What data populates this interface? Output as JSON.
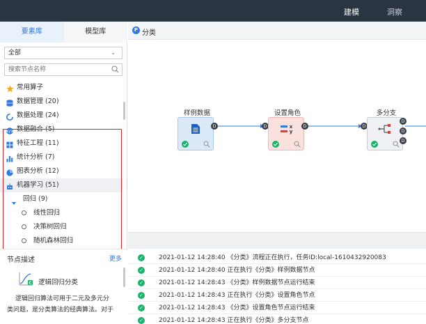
{
  "topbar": {
    "nav": [
      "建模",
      "洞察"
    ]
  },
  "sidebar": {
    "tabs": [
      "要素库",
      "模型库"
    ],
    "filter": {
      "value": "全部"
    },
    "search": {
      "placeholder": "搜索节点名称"
    },
    "items": [
      {
        "label": "常用算子",
        "icon": "star-icon",
        "color": "#f5a623"
      },
      {
        "label": "数据管理 (20)",
        "icon": "database-icon",
        "color": "#2f7ae5"
      },
      {
        "label": "数据处理 (24)",
        "icon": "process-icon",
        "color": "#2f7ae5"
      },
      {
        "label": "数据融合 (5)",
        "icon": "fusion-icon",
        "color": "#2f7ae5"
      },
      {
        "label": "特征工程 (11)",
        "icon": "grid-icon",
        "color": "#2f7ae5"
      },
      {
        "label": "统计分析 (7)",
        "icon": "bar-chart-icon",
        "color": "#2f7ae5"
      },
      {
        "label": "图表分析 (12)",
        "icon": "pie-chart-icon",
        "color": "#2f7ae5"
      },
      {
        "label": "机器学习 (51)",
        "icon": "robot-icon",
        "color": "#2f7ae5"
      },
      {
        "label": "回归 (9)",
        "icon": "caret-down-icon",
        "color": "#2f7ae5"
      },
      {
        "label": "线性回归",
        "icon": "circle-icon",
        "color": "#666666"
      },
      {
        "label": "决策树回归",
        "icon": "circle-icon",
        "color": "#666666"
      },
      {
        "label": "随机森林回归",
        "icon": "circle-icon",
        "color": "#666666"
      }
    ],
    "description": {
      "header": "节点描述",
      "more": "更多",
      "title": "逻辑回归分类",
      "text_line1": "逻辑回归算法可用于二元及多元分",
      "text_line2": "类问题，是分类算法的经典算法。对于"
    }
  },
  "canvas": {
    "title": "分类",
    "nodes": [
      {
        "label": "样例数据",
        "port": "D"
      },
      {
        "label": "设置角色",
        "port": "D"
      },
      {
        "label": "多分支",
        "port": "D"
      }
    ],
    "status_colors": {
      "ok": "#19b36b"
    }
  },
  "log": [
    "2021-01-12 14:28:40 《分类》流程正在执行，任务ID:local-1610432920083",
    "2021-01-12 14:28:40 正在执行《分类》样例数据节点",
    "2021-01-12 14:28:43 《分类》样例数据节点运行结束",
    "2021-01-12 14:28:43 正在执行《分类》设置角色节点",
    "2021-01-12 14:28:43 《分类》设置角色节点运行结束",
    "2021-01-12 14:28:43 正在执行《分类》多分支节点"
  ]
}
